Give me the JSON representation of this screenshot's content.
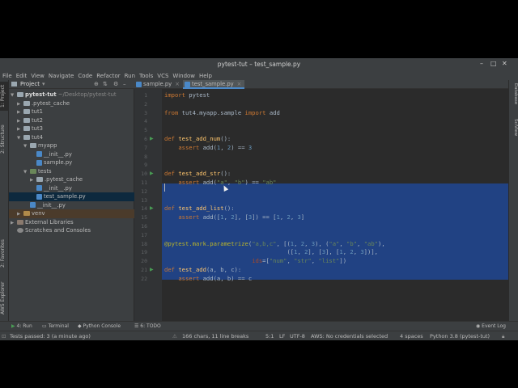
{
  "window": {
    "title": "pytest-tut – test_sample.py"
  },
  "menu": [
    "File",
    "Edit",
    "View",
    "Navigate",
    "Code",
    "Refactor",
    "Run",
    "Tools",
    "VCS",
    "Window",
    "Help"
  ],
  "project_panel": {
    "label": "Project"
  },
  "left_tool_tabs": [
    "1: Project",
    "2: Structure",
    "2: Favorites",
    "AWS Explorer"
  ],
  "right_tool_tabs": [
    "Database",
    "SciView"
  ],
  "tree": [
    {
      "label": "pytest-tut",
      "path": "~/Desktop/pytest-tut"
    },
    {
      "label": ".pytest_cache"
    },
    {
      "label": "tut1"
    },
    {
      "label": "tut2"
    },
    {
      "label": "tut3"
    },
    {
      "label": "tut4"
    },
    {
      "label": "myapp"
    },
    {
      "label": "__init__.py"
    },
    {
      "label": "sample.py"
    },
    {
      "label": "tests"
    },
    {
      "label": ".pytest_cache"
    },
    {
      "label": "__init__.py"
    },
    {
      "label": "test_sample.py"
    },
    {
      "label": "__init__.py"
    },
    {
      "label": "venv"
    },
    {
      "label": "External Libraries"
    },
    {
      "label": "Scratches and Consoles"
    }
  ],
  "tabs": [
    {
      "label": "sample.py"
    },
    {
      "label": "test_sample.py"
    }
  ],
  "code_lines": [
    "import pytest",
    "",
    "from tut4.myapp.sample import add",
    "",
    "",
    "def test_add_num():",
    "    assert add(1, 2) == 3",
    "",
    "",
    "def test_add_str():",
    "    assert add(\"a\", \"b\") == \"ab\"",
    "",
    "",
    "def test_add_list():",
    "    assert add([1, 2], [3]) == [1, 2, 3]",
    "",
    "",
    "@pytest.mark.parametrize(\"a,b,c\", [(1, 2, 3), (\"a\", \"b\", \"ab\"),",
    "                                   ([1, 2], [3], [1, 2, 3])],",
    "                         ids=[\"num\", \"str\", \"list\"])",
    "def test_add(a, b, c):",
    "    assert add(a, b) == c",
    ""
  ],
  "line_numbers": [
    "1",
    "2",
    "3",
    "4",
    "5",
    "6",
    "7",
    "8",
    "9",
    "10",
    "11",
    "12",
    "13",
    "14",
    "15",
    "16",
    "17",
    "18",
    "19",
    "20",
    "21",
    "22"
  ],
  "tool_windows": [
    "4: Run",
    "Terminal",
    "Python Console",
    "6: TODO",
    "Event Log"
  ],
  "status": {
    "message": "Tests passed: 3 (a minute ago)",
    "selection": "166 chars, 11 line breaks",
    "position": "5:1",
    "line_sep": "LF",
    "encoding": "UTF-8",
    "aws": "AWS: No credentials selected",
    "indent": "4 spaces",
    "interpreter": "Python 3.8 (pytest-tut)"
  },
  "colors": {
    "selection": "#214283",
    "editor_bg": "#2b2b2b",
    "keyword": "#cc7832",
    "string": "#6a8759",
    "number": "#6897bb",
    "function": "#ffc66d"
  }
}
